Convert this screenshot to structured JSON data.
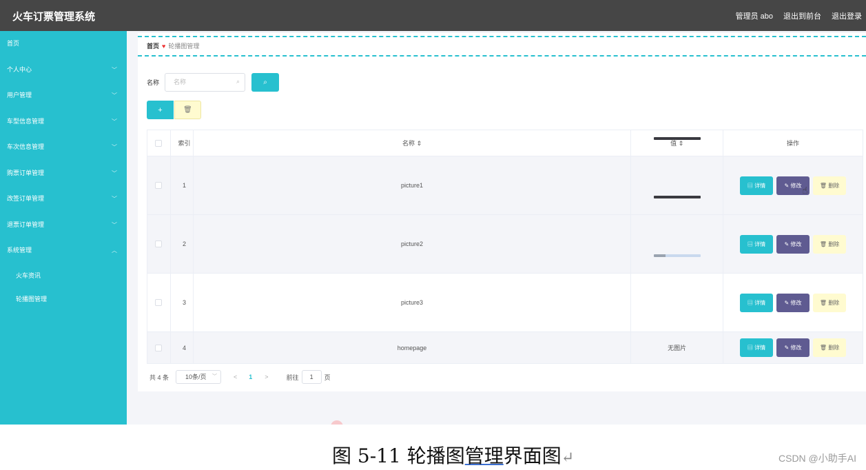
{
  "header": {
    "title": "火车订票管理系统",
    "admin": "管理员 abo",
    "back_front": "退出到前台",
    "logout": "退出登录"
  },
  "sidebar": {
    "items": [
      {
        "label": "首页"
      },
      {
        "label": "个人中心"
      },
      {
        "label": "用户管理"
      },
      {
        "label": "车型信息管理"
      },
      {
        "label": "车次信息管理"
      },
      {
        "label": "购票订单管理"
      },
      {
        "label": "改签订单管理"
      },
      {
        "label": "退票订单管理"
      },
      {
        "label": "系统管理"
      }
    ],
    "sub_items": [
      {
        "label": "火车资讯"
      },
      {
        "label": "轮播图管理"
      }
    ]
  },
  "breadcrumb": {
    "home": "首页",
    "current": "轮播图管理"
  },
  "search": {
    "label": "名称",
    "placeholder": "名称"
  },
  "table": {
    "headers": {
      "index": "索引",
      "name": "名称 ⇕",
      "value": "值 ⇕",
      "ops": "操作"
    },
    "rows": [
      {
        "index": "1",
        "name": "picture1",
        "value": ""
      },
      {
        "index": "2",
        "name": "picture2",
        "value": ""
      },
      {
        "index": "3",
        "name": "picture3",
        "value": ""
      },
      {
        "index": "4",
        "name": "homepage",
        "value": "无图片"
      }
    ],
    "op_labels": {
      "detail": "▤ 详情",
      "edit": "✎ 修改",
      "delete": "🗑 删除"
    }
  },
  "pagination": {
    "total": "共 4 条",
    "page_size": "10条/页",
    "prev": "<",
    "current": "1",
    "next": ">",
    "goto": "前往",
    "goto_value": "1",
    "unit": "页"
  },
  "caption": {
    "prefix": "图 5-11 轮播图",
    "underlined": "管理",
    "suffix": "界面图",
    "mark": "↵"
  },
  "watermark": "CSDN @小助手AI",
  "colors": {
    "accent": "#27c0cf",
    "header": "#464646",
    "edit": "#5f5b91",
    "delete": "#fffbd0"
  }
}
